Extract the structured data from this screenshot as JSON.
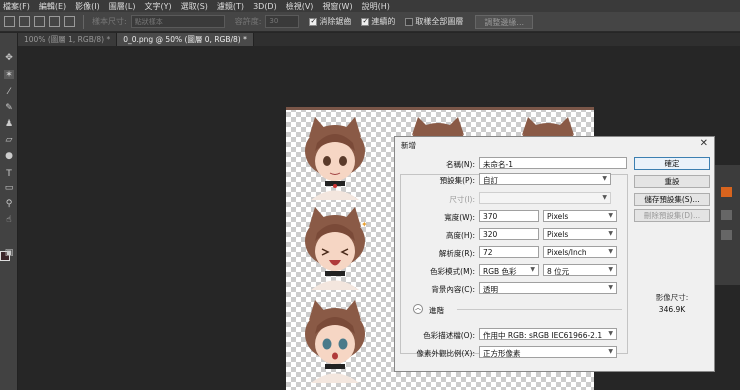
{
  "menu": [
    "檔案(F)",
    "編輯(E)",
    "影像(I)",
    "圖層(L)",
    "文字(Y)",
    "選取(S)",
    "濾鏡(T)",
    "3D(D)",
    "檢視(V)",
    "視窗(W)",
    "說明(H)"
  ],
  "options": {
    "size_label": "樣本尺寸:",
    "size_value": "點狀樣本",
    "tolerance_label": "容許度:",
    "tolerance_value": "30",
    "anti_alias": "消除鋸齒",
    "contiguous": "連續的",
    "sample_all": "取樣全部圖層",
    "refine_button": "調整邊緣..."
  },
  "tabs": [
    "100% (圖層 1, RGB/8) *",
    "0_0.png @ 50% (圖層 0, RGB/8) *"
  ],
  "dialog": {
    "title": "新增",
    "name_label": "名稱(N):",
    "name_value": "未命名-1",
    "preset_label": "預設集(P):",
    "preset_value": "自訂",
    "size_label": "尺寸(I):",
    "width_label": "寬度(W):",
    "width_value": "370",
    "width_unit": "Pixels",
    "height_label": "高度(H):",
    "height_value": "320",
    "height_unit": "Pixels",
    "res_label": "解析度(R):",
    "res_value": "72",
    "res_unit": "Pixels/Inch",
    "mode_label": "色彩模式(M):",
    "mode_value": "RGB 色彩",
    "bits_value": "8 位元",
    "bg_label": "背景內容(C):",
    "bg_value": "透明",
    "advanced_label": "進階",
    "profile_label": "色彩描述檔(O):",
    "profile_value": "作用中 RGB:  sRGB IEC61966-2.1",
    "aspect_label": "像素外觀比例(X):",
    "aspect_value": "正方形像素",
    "ok": "確定",
    "reset": "重設",
    "save_preset": "儲存預設集(S)...",
    "delete_preset": "刪除預設集(D)...",
    "image_size_label": "影像尺寸:",
    "image_size_value": "346.9K"
  }
}
